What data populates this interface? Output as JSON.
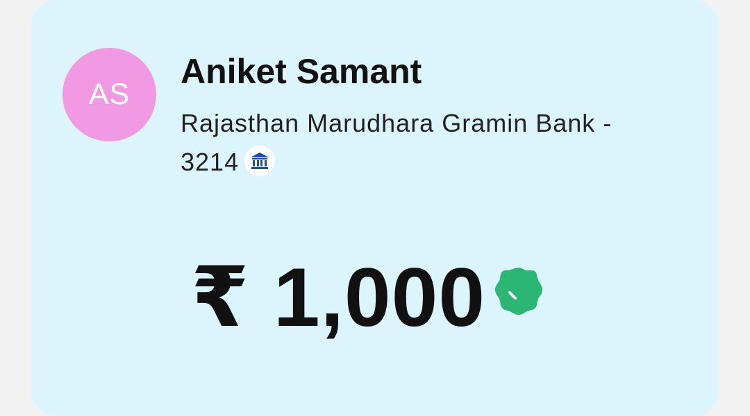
{
  "payee": {
    "initials": "AS",
    "avatar_color": "#f19ae3",
    "name": "Aniket Samant",
    "bank_line": "Rajasthan Marudhara Gramin Bank - 3214",
    "bank_icon": "bank-icon"
  },
  "payment": {
    "amount": "₹ 1,000",
    "status_icon": "success-badge-icon",
    "status_color": "#2bb673"
  },
  "card": {
    "background": "#dcf4fc"
  }
}
